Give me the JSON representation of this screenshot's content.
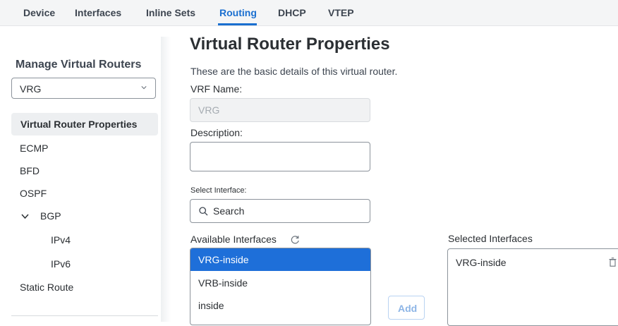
{
  "top_tabs": [
    {
      "label": "Device"
    },
    {
      "label": "Interfaces"
    },
    {
      "label": "Inline Sets"
    },
    {
      "label": "Routing",
      "active": true
    },
    {
      "label": "DHCP"
    },
    {
      "label": "VTEP"
    }
  ],
  "sidebar": {
    "title": "Manage Virtual Routers",
    "router_select": {
      "value": "VRG"
    },
    "items": [
      {
        "label": "Virtual Router Properties",
        "active": true
      },
      {
        "label": "ECMP"
      },
      {
        "label": "BFD"
      },
      {
        "label": "OSPF"
      },
      {
        "label": "BGP",
        "expanded": true
      },
      {
        "label": "IPv4"
      },
      {
        "label": "IPv6"
      },
      {
        "label": "Static Route"
      }
    ]
  },
  "main": {
    "title": "Virtual Router Properties",
    "subtitle": "These are the basic details of this virtual router.",
    "vrf_name": {
      "label": "VRF Name:",
      "value": "VRG"
    },
    "description": {
      "label": "Description:",
      "value": ""
    },
    "select_interface": {
      "label": "Select Interface:",
      "placeholder": "Search"
    },
    "available_interfaces": {
      "label": "Available Interfaces",
      "items": [
        "VRG-inside",
        "VRB-inside",
        "inside"
      ],
      "selected_index": 0
    },
    "add_button": "Add",
    "selected_interfaces": {
      "label": "Selected Interfaces",
      "items": [
        "VRG-inside"
      ]
    }
  },
  "colors": {
    "accent": "#1a6fd0",
    "selected_row": "#1e6fd9",
    "disabled_button_text": "#8db5e6"
  }
}
